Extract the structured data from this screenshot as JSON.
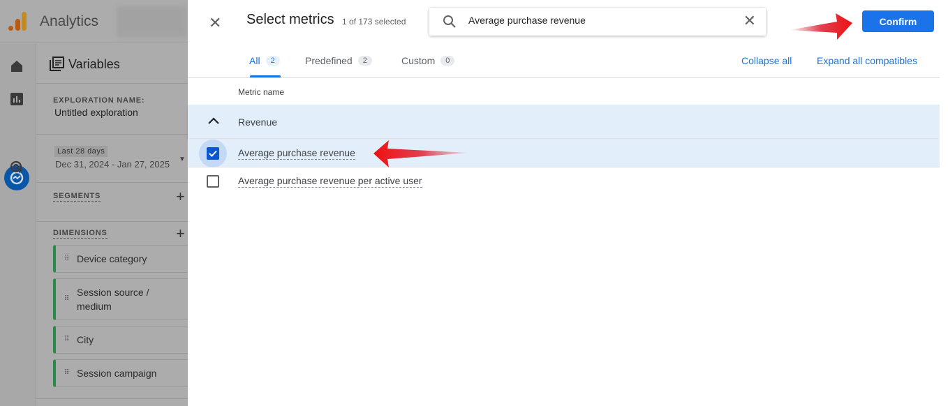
{
  "app": {
    "title": "Analytics"
  },
  "variables": {
    "title": "Variables",
    "exploration_name_label": "EXPLORATION NAME:",
    "exploration_name": "Untitled exploration",
    "date_chip": "Last 28 days",
    "date_range": "Dec 31, 2024 - Jan 27, 2025",
    "segments_label": "SEGMENTS",
    "dimensions_label": "DIMENSIONS",
    "dimensions": [
      "Device category",
      "Session source / medium",
      "City",
      "Session campaign"
    ]
  },
  "dialog": {
    "title": "Select metrics",
    "count": "1 of 173 selected",
    "search_value": "Average purchase revenue",
    "confirm_label": "Confirm",
    "tabs": [
      {
        "label": "All",
        "count": "2"
      },
      {
        "label": "Predefined",
        "count": "2"
      },
      {
        "label": "Custom",
        "count": "0"
      }
    ],
    "collapse_all": "Collapse all",
    "expand_all": "Expand all compatibles",
    "column_header": "Metric name",
    "group": "Revenue",
    "metrics": [
      {
        "label": "Average purchase revenue",
        "checked": true
      },
      {
        "label": "Average purchase revenue per active user",
        "checked": false
      }
    ]
  },
  "colors": {
    "accent": "#1a73e8",
    "dimension_bar": "#2a8a4a",
    "annotation_arrow": "#ee1111"
  }
}
